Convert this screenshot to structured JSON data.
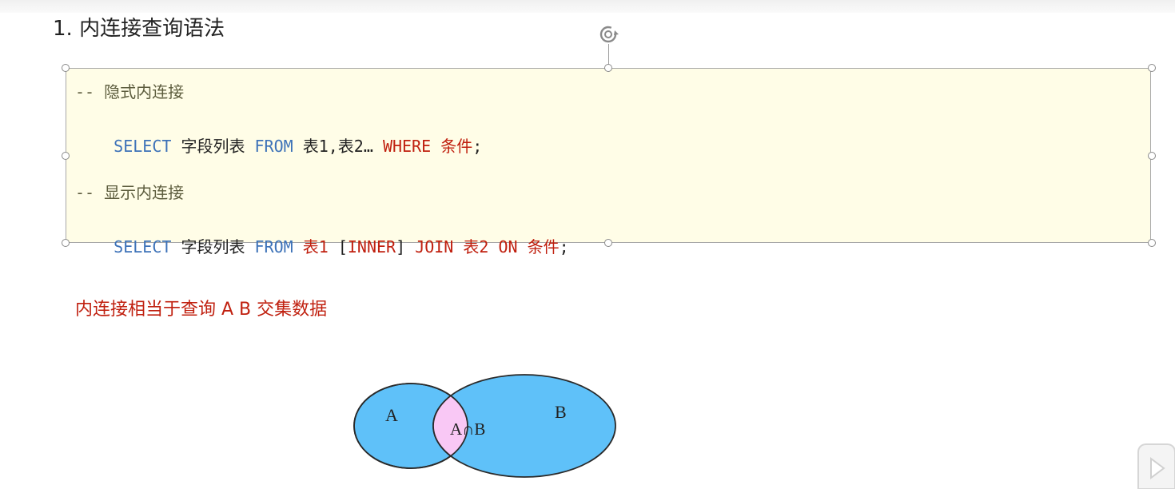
{
  "heading": "1. 内连接查询语法",
  "code": {
    "comment1": "-- 隐式内连接",
    "line1": {
      "kw_select": "SELECT",
      "fields": " 字段列表 ",
      "kw_from": "FROM",
      "tables": " 表1,表2… ",
      "kw_where": "WHERE",
      "condition": " 条件",
      "end": ";"
    },
    "comment2": "-- 显示内连接",
    "line2": {
      "kw_select": "SELECT",
      "fields": " 字段列表 ",
      "kw_from": "FROM",
      "table1": " 表1",
      "bracket_open": " [",
      "kw_inner": "INNER",
      "bracket_close": "] ",
      "kw_join": "JOIN",
      "table2": " 表2",
      "kw_on": " ON",
      "condition": " 条件",
      "end": ";"
    }
  },
  "note": "内连接相当于查询 A B 交集数据",
  "venn": {
    "label_a": "A",
    "label_b": "B",
    "label_intersection": "A∩B",
    "colors": {
      "circle_fill": "#5fc1f9",
      "intersection_fill": "#f9c8f5",
      "stroke": "#2a2a2a"
    }
  },
  "colors": {
    "keyword": "#3d72b8",
    "highlight_red": "#c0200f",
    "code_background": "#fffde7"
  }
}
